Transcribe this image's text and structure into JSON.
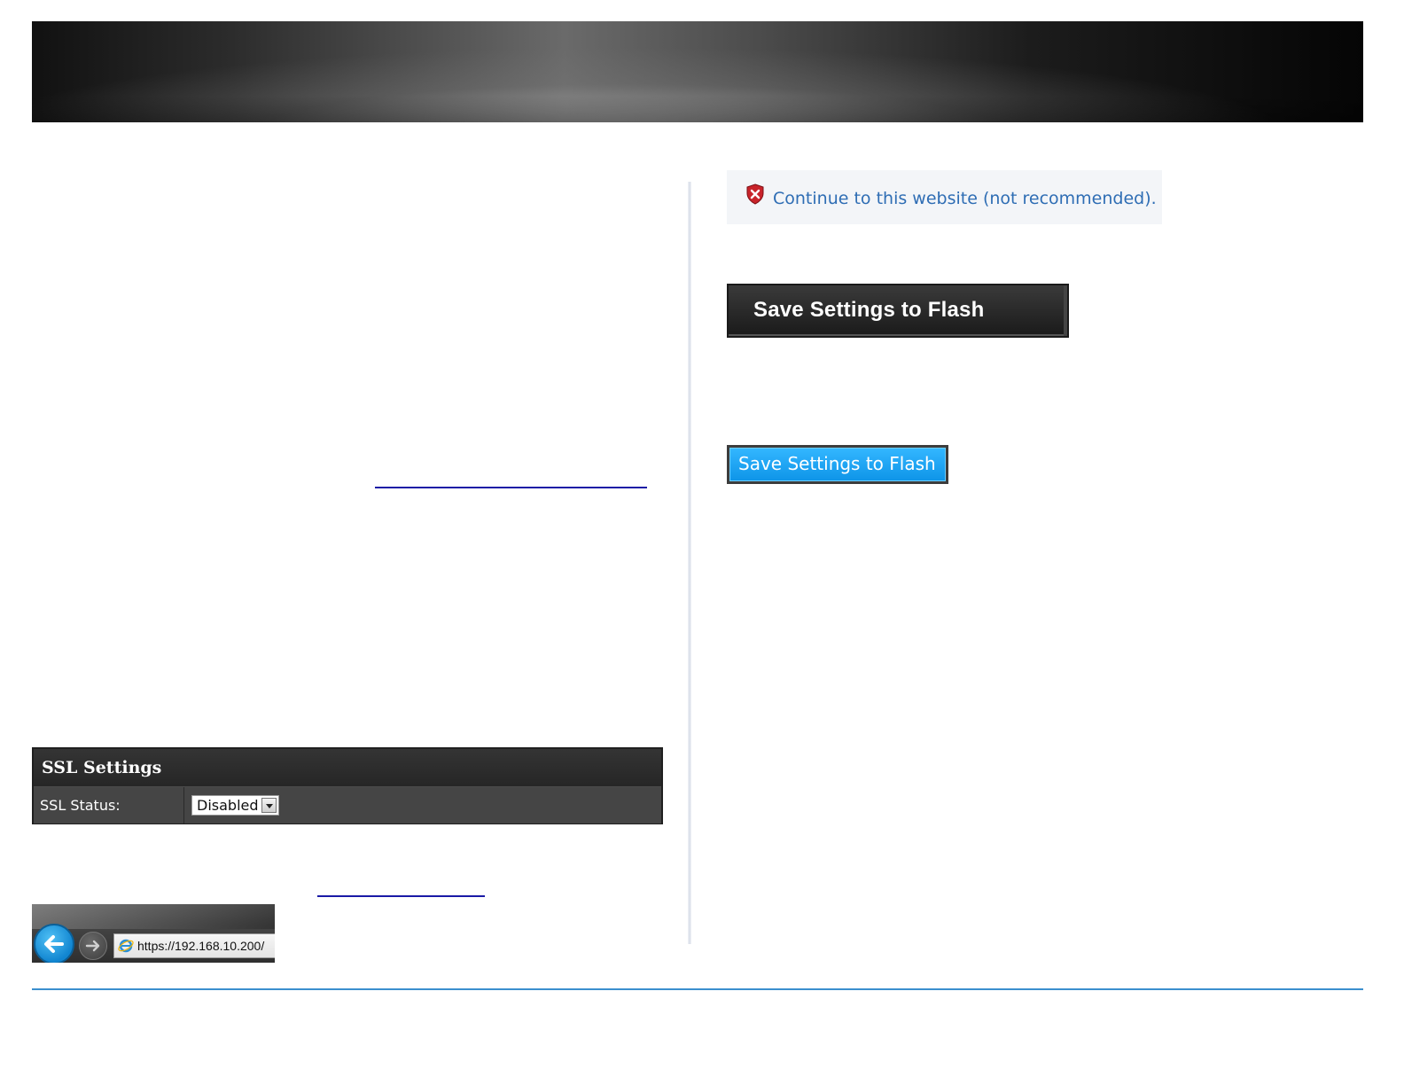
{
  "warning": {
    "continue_text": "Continue to this website (not recommended)."
  },
  "buttons": {
    "save_dark_label": "Save Settings to Flash",
    "save_blue_label": "Save Settings to Flash"
  },
  "ssl_panel": {
    "title": "SSL Settings",
    "status_label": "SSL Status:",
    "status_value": "Disabled"
  },
  "browser": {
    "address": "https://192.168.10.200/"
  },
  "colors": {
    "link_blue": "#2e6db4",
    "button_blue": "#1a9ff0",
    "footer_rule": "#3b8fce"
  }
}
